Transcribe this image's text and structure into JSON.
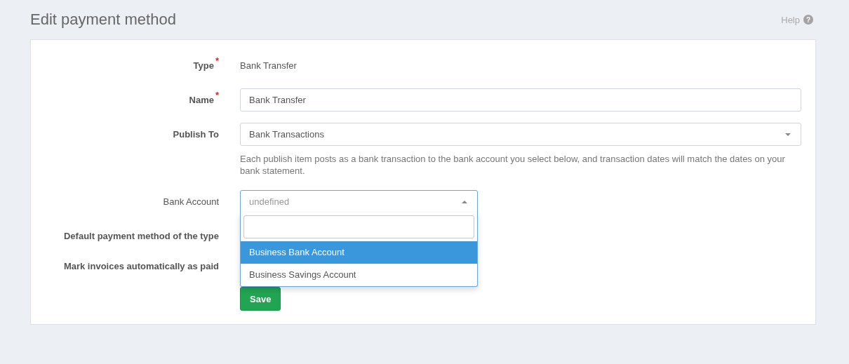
{
  "page": {
    "title": "Edit payment method",
    "help": "Help",
    "help_icon": "?"
  },
  "required_mark": "*",
  "fields": [
    {
      "kind": "static",
      "label": "Type",
      "required": true,
      "bold": true,
      "value": "Bank Transfer"
    },
    {
      "kind": "text",
      "label": "Name",
      "required": true,
      "bold": true,
      "value": "Bank Transfer"
    },
    {
      "kind": "select",
      "label": "Publish To",
      "required": false,
      "bold": true,
      "value": "Bank Transactions",
      "help": "Each publish item posts as a bank transaction to the bank account you select below, and transaction dates will match the dates on your bank statement."
    },
    {
      "kind": "dropdown",
      "label": "Bank Account",
      "required": false,
      "bold": false,
      "placeholder": "undefined",
      "expanded": true,
      "options": [
        {
          "label": "Business Bank Account",
          "selected": true
        },
        {
          "label": "Business Savings Account",
          "selected": false
        }
      ]
    },
    {
      "kind": "covered",
      "label": "Default payment method of the type",
      "required": false,
      "bold": true
    },
    {
      "kind": "covered",
      "label": "Mark invoices automatically as paid",
      "required": false,
      "bold": true
    }
  ],
  "save_button": "Save"
}
